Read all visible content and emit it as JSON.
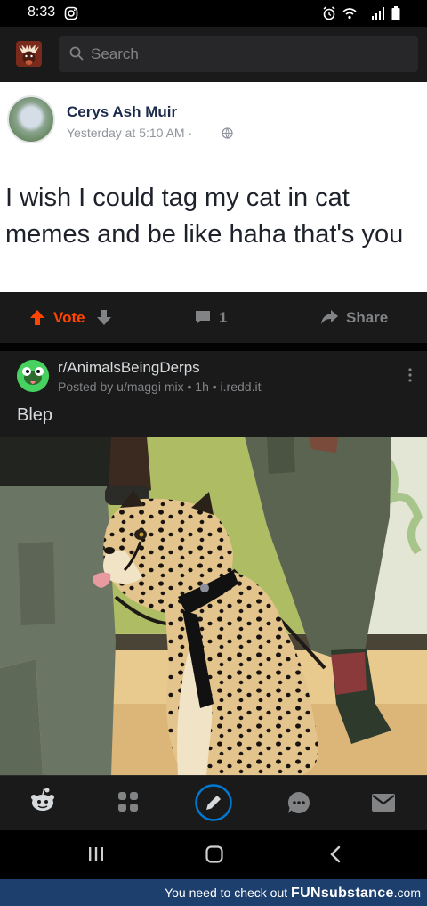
{
  "status_bar": {
    "time": "8:33",
    "icons": [
      "instagram-icon",
      "alarm-icon",
      "wifi-icon",
      "signal-icon",
      "battery-icon"
    ]
  },
  "header": {
    "search_placeholder": "Search",
    "icons": [
      "avatar-icon",
      "search-icon"
    ]
  },
  "facebook_post": {
    "author": "Cerys Ash Muir",
    "timestamp": "Yesterday at 5:10 AM ·",
    "text": "I wish I could tag my cat in cat memes and be like haha that's you"
  },
  "post_actions": {
    "vote_label": "Vote",
    "comment_count": "1",
    "share_label": "Share"
  },
  "post": {
    "subreddit": "r/AnimalsBeingDerps",
    "meta": "Posted by u/maggi mix • 1h • i.redd.it",
    "title": "Blep"
  },
  "bottom_nav": [
    "home-icon",
    "communities-icon",
    "create-post-icon",
    "chat-icon",
    "inbox-icon"
  ],
  "system_nav": [
    "recents-icon",
    "home-button-icon",
    "back-icon"
  ],
  "watermark": {
    "prefix": "You need to check out",
    "brand": "FUNsubstance",
    "suffix": ".com"
  },
  "colors": {
    "upvote": "#ff4500",
    "background": "#1a1a1b",
    "accent_blue": "#0079d3",
    "watermark_bar": "#1d3f6e"
  }
}
